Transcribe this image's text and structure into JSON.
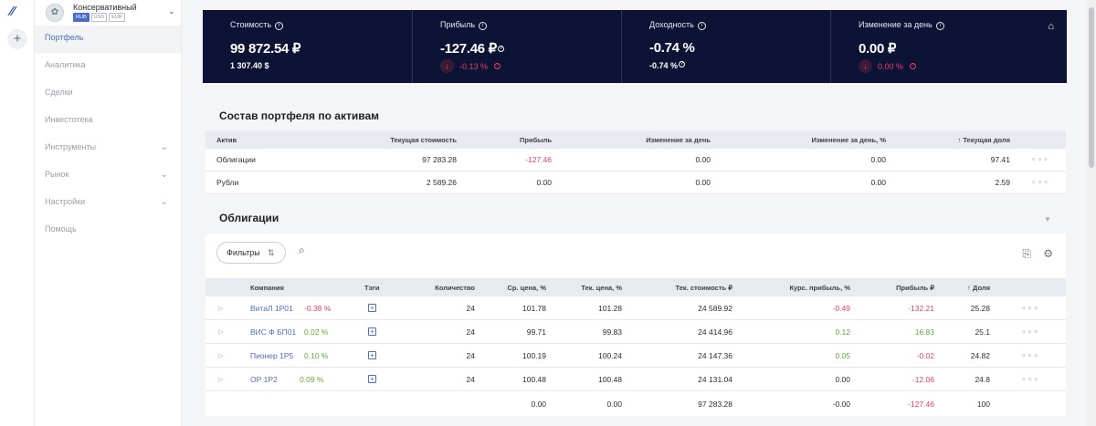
{
  "sidebar": {
    "account_name": "Консервативный",
    "currencies": [
      "RUB",
      "USD",
      "EUR"
    ],
    "items": [
      {
        "label": "Портфель",
        "active": true,
        "chevron": false
      },
      {
        "label": "Аналитика",
        "active": false,
        "chevron": false
      },
      {
        "label": "Сделки",
        "active": false,
        "chevron": false
      },
      {
        "label": "Инвестотека",
        "active": false,
        "chevron": false
      },
      {
        "label": "Инструменты",
        "active": false,
        "chevron": true
      },
      {
        "label": "Рынок",
        "active": false,
        "chevron": true
      },
      {
        "label": "Настройки",
        "active": false,
        "chevron": true
      },
      {
        "label": "Помощь",
        "active": false,
        "chevron": false
      }
    ]
  },
  "summary": {
    "value": {
      "label": "Стоимость",
      "main": "99 872.54 ₽",
      "sub": "1 307.40 $"
    },
    "profit": {
      "label": "Прибыль",
      "main": "-127.46 ₽",
      "delta": "-0.13 %"
    },
    "yield": {
      "label": "Доходность",
      "main": "-0.74 %",
      "sub": "-0.74 %"
    },
    "day_change": {
      "label": "Изменение за день",
      "main": "0.00 ₽",
      "delta": "0.00 %"
    }
  },
  "assets": {
    "title": "Состав портфеля по активам",
    "headers": {
      "asset": "Актив",
      "current_value": "Текущая стоимость",
      "profit": "Прибыль",
      "day_change": "Изменение за день",
      "day_change_pct": "Изменение за день, %",
      "share": "Текущая доля"
    },
    "rows": [
      {
        "asset": "Облигации",
        "current_value": "97 283.28",
        "profit": "-127.46",
        "day_change": "0.00",
        "day_change_pct": "0.00",
        "share": "97.41",
        "more": "∘∘∘"
      },
      {
        "asset": "Рубли",
        "current_value": "2 589.26",
        "profit": "0.00",
        "day_change": "0.00",
        "day_change_pct": "0.00",
        "share": "2.59",
        "more": "∘∘∘"
      }
    ]
  },
  "bonds": {
    "title": "Облигации",
    "filter_label": "Фильтры",
    "headers": {
      "company": "Компания",
      "tags": "Тэги",
      "qty": "Количество",
      "avg_price": "Ср. цена, %",
      "cur_price": "Тек. цена, %",
      "cur_value": "Тек. стоимость ₽",
      "fx_profit": "Курс. прибыль, %",
      "profit": "Прибыль ₽",
      "share": "Доля"
    },
    "rows": [
      {
        "company": "ВитаЛ 1Р01",
        "change": "-0.38 %",
        "change_sign": "neg",
        "qty": "24",
        "avg_price": "101.78",
        "cur_price": "101.28",
        "cur_value": "24 589.92",
        "fx_profit": "-0.49",
        "fx_sign": "neg",
        "profit": "-132.21",
        "profit_sign": "neg",
        "share": "25.28",
        "more": "∘∘∘"
      },
      {
        "company": "ВИС Ф БП01",
        "change": "0.02 %",
        "change_sign": "pos",
        "qty": "24",
        "avg_price": "99.71",
        "cur_price": "99.83",
        "cur_value": "24 414.96",
        "fx_profit": "0.12",
        "fx_sign": "pos",
        "profit": "16.83",
        "profit_sign": "pos",
        "share": "25.1",
        "more": "∘∘∘"
      },
      {
        "company": "Пионер 1Р5",
        "change": "0.10 %",
        "change_sign": "pos",
        "qty": "24",
        "avg_price": "100.19",
        "cur_price": "100.24",
        "cur_value": "24 147.36",
        "fx_profit": "0.05",
        "fx_sign": "pos",
        "profit": "-0.02",
        "profit_sign": "neg",
        "share": "24.82",
        "more": "∘∘∘"
      },
      {
        "company": "ОР 1Р2",
        "change": "0.09 %",
        "change_sign": "pos",
        "qty": "24",
        "avg_price": "100.48",
        "cur_price": "100.48",
        "cur_value": "24 131.04",
        "fx_profit": "0.00",
        "fx_sign": "none",
        "profit": "-12.06",
        "profit_sign": "neg",
        "share": "24.8",
        "more": "∘∘∘"
      }
    ],
    "totals": {
      "avg_price": "0.00",
      "cur_price": "0.00",
      "cur_value": "97 283.28",
      "fx_profit": "-0.00",
      "profit": "-127.46",
      "share": "100"
    }
  },
  "colors": {
    "header_bg": "#0d1335",
    "accent": "#4b6dc6",
    "negative": "#e5406b",
    "positive": "#5dad2e"
  }
}
